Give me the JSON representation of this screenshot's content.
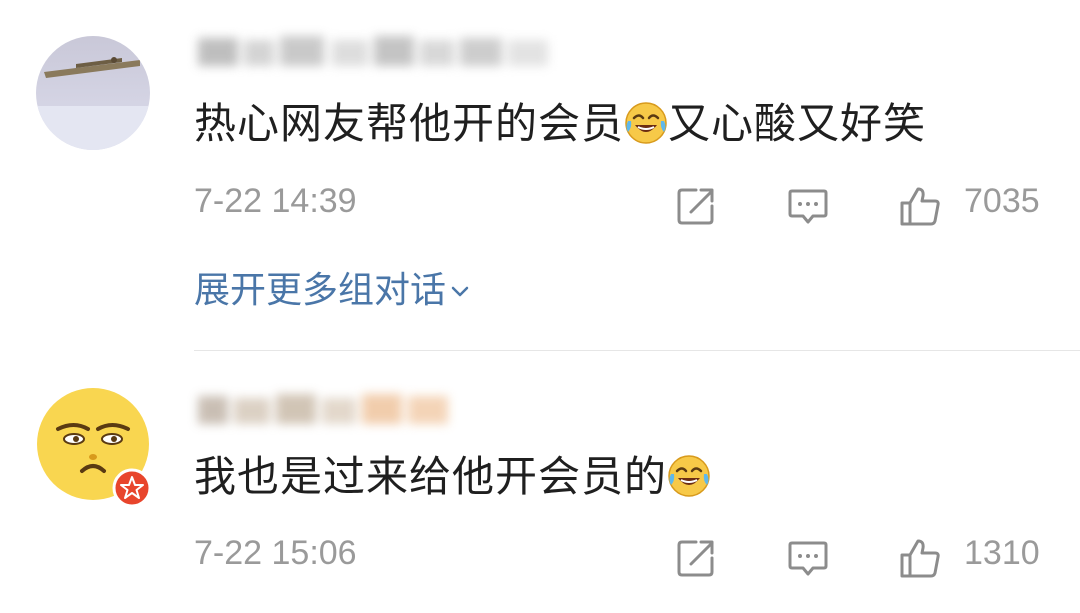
{
  "comments": [
    {
      "text_before_emoji": "热心网友帮他开的会员",
      "emoji": "laugh-cry-emoji",
      "text_after_emoji": "又心酸又好笑",
      "timestamp": "7-22 14:39",
      "like_count": "7035",
      "expand_label": "展开更多组对话"
    },
    {
      "text_before_emoji": "我也是过来给他开会员的",
      "emoji": "laugh-cry-emoji",
      "text_after_emoji": "",
      "timestamp": "7-22 15:06",
      "like_count": "1310"
    }
  ],
  "icons": {
    "share": "share-icon",
    "reply": "comment-icon",
    "like": "thumbs-up-icon",
    "expand": "chevron-down-icon",
    "badge": "verified-badge-icon"
  },
  "colors": {
    "text": "#1f1f1f",
    "meta": "#9a9a9a",
    "link": "#4a76a8",
    "divider": "#e6e6e6",
    "badge": "#e8452c"
  }
}
